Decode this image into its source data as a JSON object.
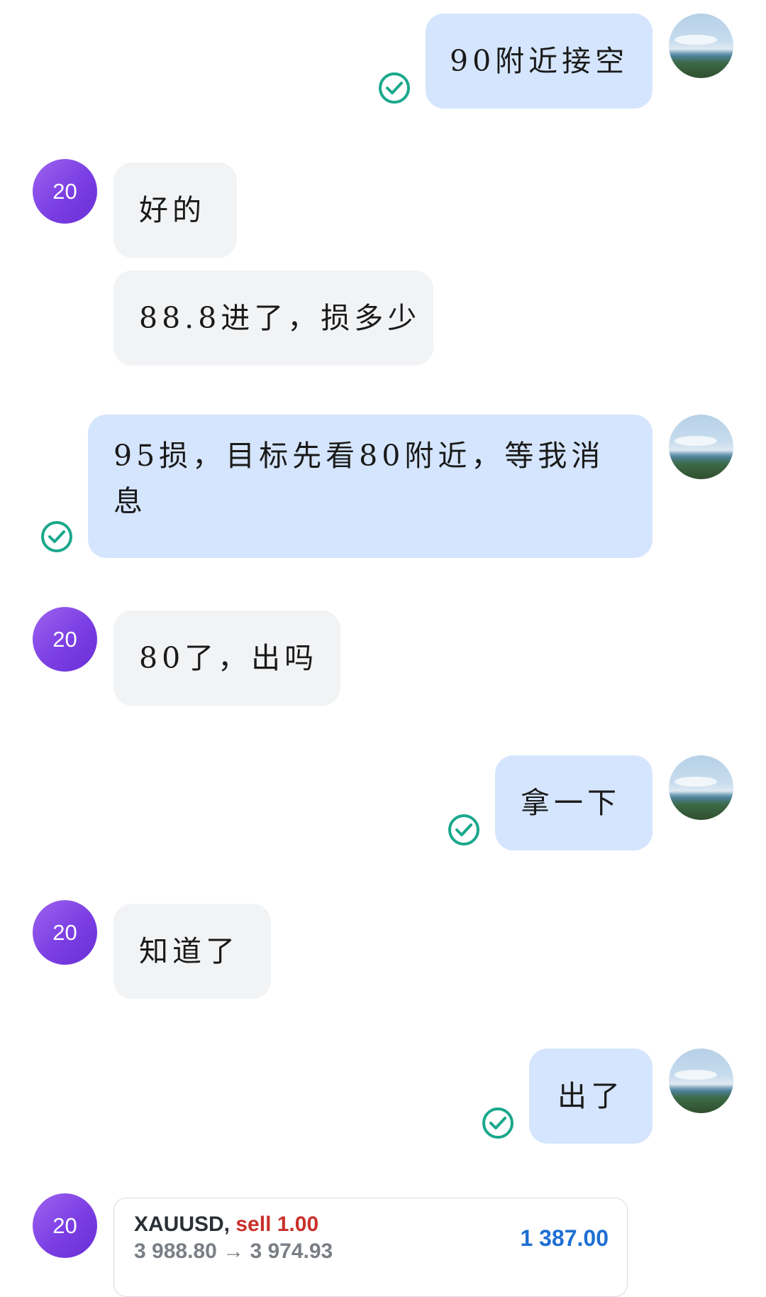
{
  "colors": {
    "outgoing_bubble": "#d5e5fd",
    "incoming_bubble": "#f2f3f5",
    "avatar_purple": "#7b3ee3",
    "read_check": "#1aa88c",
    "sell_red": "#c9302c",
    "profit_blue": "#1e6fd3"
  },
  "contact": {
    "avatar_label": "20"
  },
  "messages": [
    {
      "direction": "out",
      "text": "90附近接空",
      "status_icon": "read-check-icon"
    },
    {
      "direction": "in",
      "text": "好的"
    },
    {
      "direction": "in",
      "text": "88.8进了，损多少"
    },
    {
      "direction": "out",
      "text": "95损，目标先看80附近，等我消息",
      "status_icon": "read-check-icon"
    },
    {
      "direction": "in",
      "text": "80了，出吗"
    },
    {
      "direction": "out",
      "text": "拿一下",
      "status_icon": "read-check-icon"
    },
    {
      "direction": "in",
      "text": "知道了"
    },
    {
      "direction": "out",
      "text": "出了",
      "status_icon": "read-check-icon"
    }
  ],
  "trade_card": {
    "symbol": "XAUUSD,",
    "side": "sell 1.00",
    "price_line": "3 988.80 → 3 974.93",
    "profit": "1 387.00"
  }
}
